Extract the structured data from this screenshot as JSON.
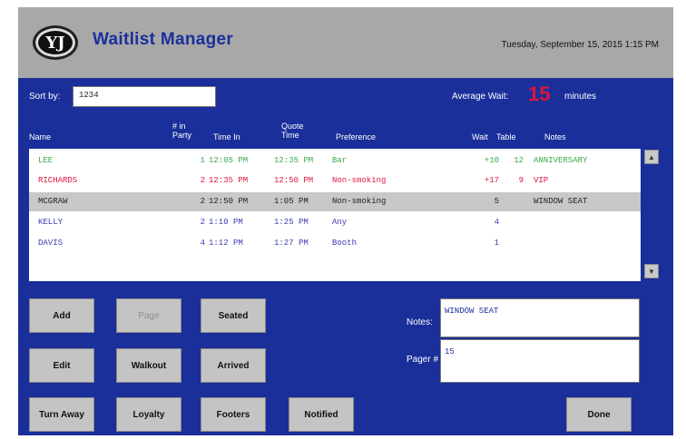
{
  "header": {
    "logo_text": "YJ",
    "title": "Waitlist Manager",
    "datetime": "Tuesday, September 15, 2015 1:15 PM"
  },
  "filter": {
    "label": "Sort by:",
    "value": "1234"
  },
  "average_wait": {
    "label": "Average Wait:",
    "value": "15",
    "unit": "minutes"
  },
  "table": {
    "columns": [
      {
        "key": "name",
        "label": "Name"
      },
      {
        "key": "party",
        "label": "# in Party"
      },
      {
        "key": "time_in",
        "label": "Time In"
      },
      {
        "key": "quote",
        "label": "Quote Time"
      },
      {
        "key": "preference",
        "label": "Preference"
      },
      {
        "key": "wait",
        "label": "Wait"
      },
      {
        "key": "table",
        "label": "Table"
      },
      {
        "key": "notes",
        "label": "Notes"
      }
    ],
    "rows": [
      {
        "name": "LEE",
        "party": "1",
        "time_in": "12:05 PM",
        "quote": "12:35 PM",
        "preference": "Bar",
        "wait": "+10",
        "table": "12",
        "notes": "ANNIVERSARY",
        "color": "#3aa84a"
      },
      {
        "name": "RICHARDS",
        "party": "2",
        "time_in": "12:35 PM",
        "quote": "12:50 PM",
        "preference": "Non-smoking",
        "wait": "+17",
        "table": "9",
        "notes": "VIP",
        "color": "#e0143c"
      },
      {
        "name": "MCGRAW",
        "party": "2",
        "time_in": "12:50 PM",
        "quote": "1:05 PM",
        "preference": "Non-smoking",
        "wait": "5",
        "table": "",
        "notes": "WINDOW SEAT",
        "color": "#222222",
        "selected": true
      },
      {
        "name": "KELLY",
        "party": "2",
        "time_in": "1:10 PM",
        "quote": "1:25 PM",
        "preference": "Any",
        "wait": "4",
        "table": "",
        "notes": "",
        "color": "#3b3bb0"
      },
      {
        "name": "DAVIS",
        "party": "4",
        "time_in": "1:12 PM",
        "quote": "1:27 PM",
        "preference": "Booth",
        "wait": "1",
        "table": "",
        "notes": "",
        "color": "#3b3bb0"
      }
    ]
  },
  "buttons": {
    "add": "Add",
    "page": "Page",
    "seated": "Seated",
    "edit": "Edit",
    "walkout": "Walkout",
    "arrived": "Arrived",
    "turn_away": "Turn Away",
    "loyalty": "Loyalty",
    "footers": "Footers",
    "notified": "Notified",
    "done": "Done"
  },
  "details": {
    "notes_label": "Notes:",
    "notes_value": "WINDOW SEAT",
    "pager_label": "Pager #",
    "pager_value": "15"
  },
  "icons": {
    "scroll_up": "▲",
    "scroll_down": "▼"
  },
  "colors": {
    "panel": "#1a2f9a",
    "header": "#a8a8a8",
    "accent_red": "#e0143c",
    "accent_green": "#3aa84a"
  }
}
